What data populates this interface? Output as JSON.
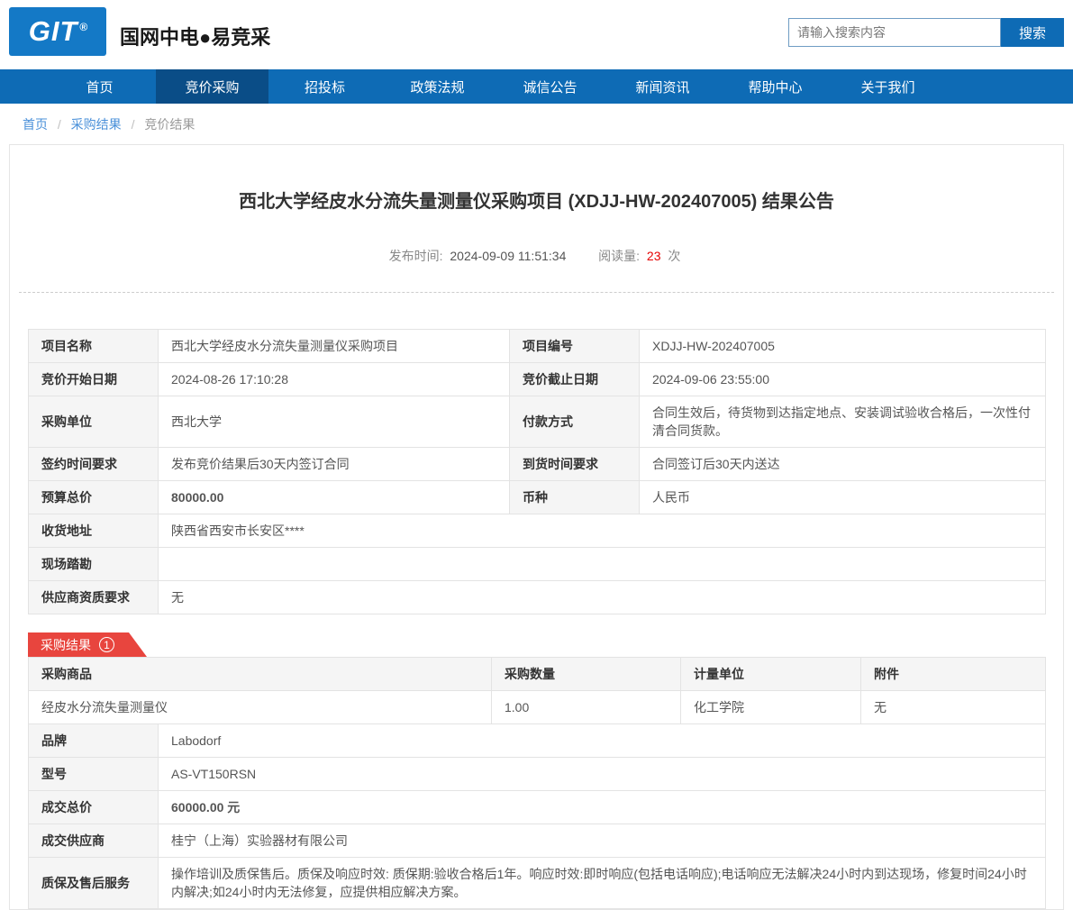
{
  "colors": {
    "nav_blue": "#0e6bb5",
    "nav_active_blue": "#0a4d87",
    "logo_blue": "#1479c6",
    "ribbon_red": "#e8453e",
    "price_red": "#e60000"
  },
  "header": {
    "logo_text": "GIT",
    "logo_reg": "®",
    "site_title": "国网中电●易竞采",
    "search": {
      "placeholder": "请输入搜索内容",
      "button": "搜索"
    }
  },
  "nav": {
    "items": [
      {
        "label": "首页",
        "active": false
      },
      {
        "label": "竞价采购",
        "active": true
      },
      {
        "label": "招投标",
        "active": false
      },
      {
        "label": "政策法规",
        "active": false
      },
      {
        "label": "诚信公告",
        "active": false
      },
      {
        "label": "新闻资讯",
        "active": false
      },
      {
        "label": "帮助中心",
        "active": false
      },
      {
        "label": "关于我们",
        "active": false
      }
    ]
  },
  "breadcrumb": {
    "separator": "/",
    "items": [
      "首页",
      "采购结果",
      "竞价结果"
    ]
  },
  "article": {
    "title": "西北大学经皮水分流失量测量仪采购项目 (XDJJ-HW-202407005) 结果公告",
    "publish_label": "发布时间:",
    "publish_time": "2024-09-09 11:51:34",
    "views_label": "阅读量:",
    "views_count": "23",
    "views_unit": "次"
  },
  "info_table": {
    "rows": [
      {
        "l1": "项目名称",
        "v1": "西北大学经皮水分流失量测量仪采购项目",
        "l2": "项目编号",
        "v2": "XDJJ-HW-202407005"
      },
      {
        "l1": "竞价开始日期",
        "v1": "2024-08-26 17:10:28",
        "l2": "竞价截止日期",
        "v2": "2024-09-06 23:55:00"
      },
      {
        "l1": "采购单位",
        "v1": "西北大学",
        "l2": "付款方式",
        "v2": "合同生效后，待货物到达指定地点、安装调试验收合格后，一次性付清合同货款。"
      },
      {
        "l1": "签约时间要求",
        "v1": "发布竞价结果后30天内签订合同",
        "l2": "到货时间要求",
        "v2": "合同签订后30天内送达"
      },
      {
        "l1": "预算总价",
        "v1": "80000.00",
        "l2": "币种",
        "v2": "人民币"
      }
    ],
    "full_rows": [
      {
        "label": "收货地址",
        "value": "陕西省西安市长安区****"
      },
      {
        "label": "现场踏勘",
        "value": ""
      },
      {
        "label": "供应商资质要求",
        "value": "无"
      }
    ]
  },
  "result_section": {
    "badge_label": "采购结果",
    "badge_number": "1"
  },
  "result_table": {
    "headers": [
      "采购商品",
      "采购数量",
      "计量单位",
      "附件"
    ],
    "row": [
      "经皮水分流失量测量仪",
      "1.00",
      "化工学院",
      "无"
    ]
  },
  "result_details": {
    "rows": [
      {
        "label": "品牌",
        "value": "Labodorf"
      },
      {
        "label": "型号",
        "value": "AS-VT150RSN"
      },
      {
        "label": "成交总价",
        "value": "60000.00 元"
      },
      {
        "label": "成交供应商",
        "value": "桂宁（上海）实验器材有限公司"
      },
      {
        "label": "质保及售后服务",
        "value": "操作培训及质保售后。质保及响应时效: 质保期:验收合格后1年。响应时效:即时响应(包括电话响应);电话响应无法解决24小时内到达现场，修复时间24小时内解决;如24小时内无法修复，应提供相应解决方案。"
      }
    ]
  }
}
